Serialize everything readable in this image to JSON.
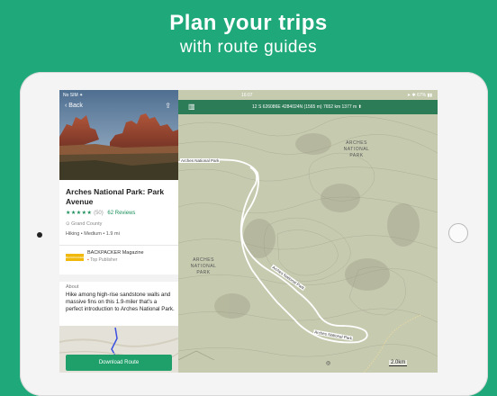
{
  "hero": {
    "line1": "Plan your trips",
    "line2": "with route guides"
  },
  "status": {
    "left": "No SIM ✦",
    "time": "16:07",
    "right": "➤ ✱ 67% ▮▮"
  },
  "side": {
    "back_label": "Back",
    "title": "Arches National Park: Park Avenue",
    "stars": "★★★★★",
    "rating_num": "(50)",
    "reviews": "62 Reviews",
    "county": "Grand County",
    "meta": "Hiking • Medium • 1.9 mi",
    "publisher": "BACKPACKER Magazine",
    "publisher_role": "Top Publisher",
    "about_header": "About",
    "about_text": "Hike among high-rise sandstone walls and massive fins on this 1.9-miler that's a perfect introduction to Arches National Park.",
    "download_label": "Download Route",
    "logo_text": "BACKPACKER",
    "photo_dots": 6,
    "photo_dot_active": 0
  },
  "mapbar": {
    "info": "12 S 626086E 4284024N (1565 m)     7652 km     1377 m ⬆"
  },
  "map": {
    "labels": {
      "arches": "ARCHES NATIONAL PARK",
      "road_top": "Arches National Park",
      "road_mid": "Arches National Park",
      "road_bot": "Arches National Park",
      "park_left": "ARCHES NATIONAL PARK"
    },
    "scale": "2.0km",
    "compass": "◎"
  }
}
